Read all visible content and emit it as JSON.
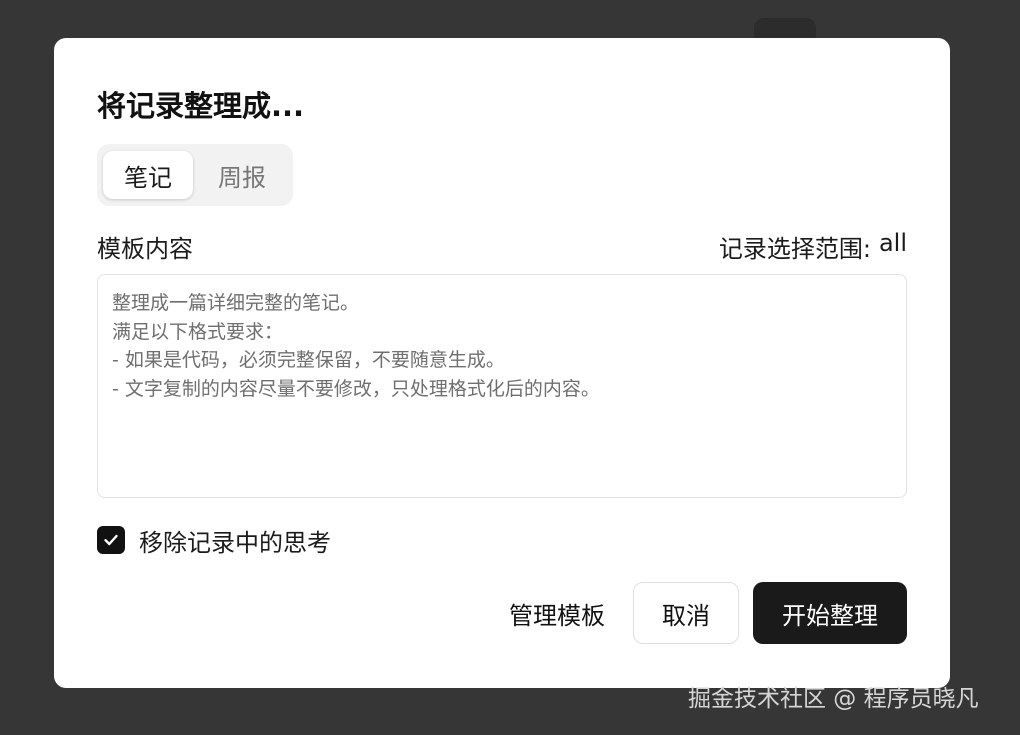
{
  "dialog": {
    "title": "将记录整理成...",
    "tabs": [
      {
        "label": "笔记",
        "active": true
      },
      {
        "label": "周报",
        "active": false
      }
    ],
    "template_label": "模板内容",
    "scope": {
      "label": "记录选择范围:",
      "value": "all"
    },
    "template_lines": [
      "整理成一篇详细完整的笔记。",
      "满足以下格式要求：",
      "- 如果是代码，必须完整保留，不要随意生成。",
      "- 文字复制的内容尽量不要修改，只处理格式化后的内容。"
    ],
    "remove_thinking": {
      "label": "移除记录中的思考",
      "checked": true
    },
    "buttons": {
      "manage": "管理模板",
      "cancel": "取消",
      "start": "开始整理"
    }
  },
  "watermark": "掘金技术社区 @ 程序员晓凡",
  "colors": {
    "backdrop": "#363636",
    "primary_button": "#1a1a1a",
    "checkbox": "#111111"
  },
  "icons": {
    "checkbox": "check-icon"
  }
}
